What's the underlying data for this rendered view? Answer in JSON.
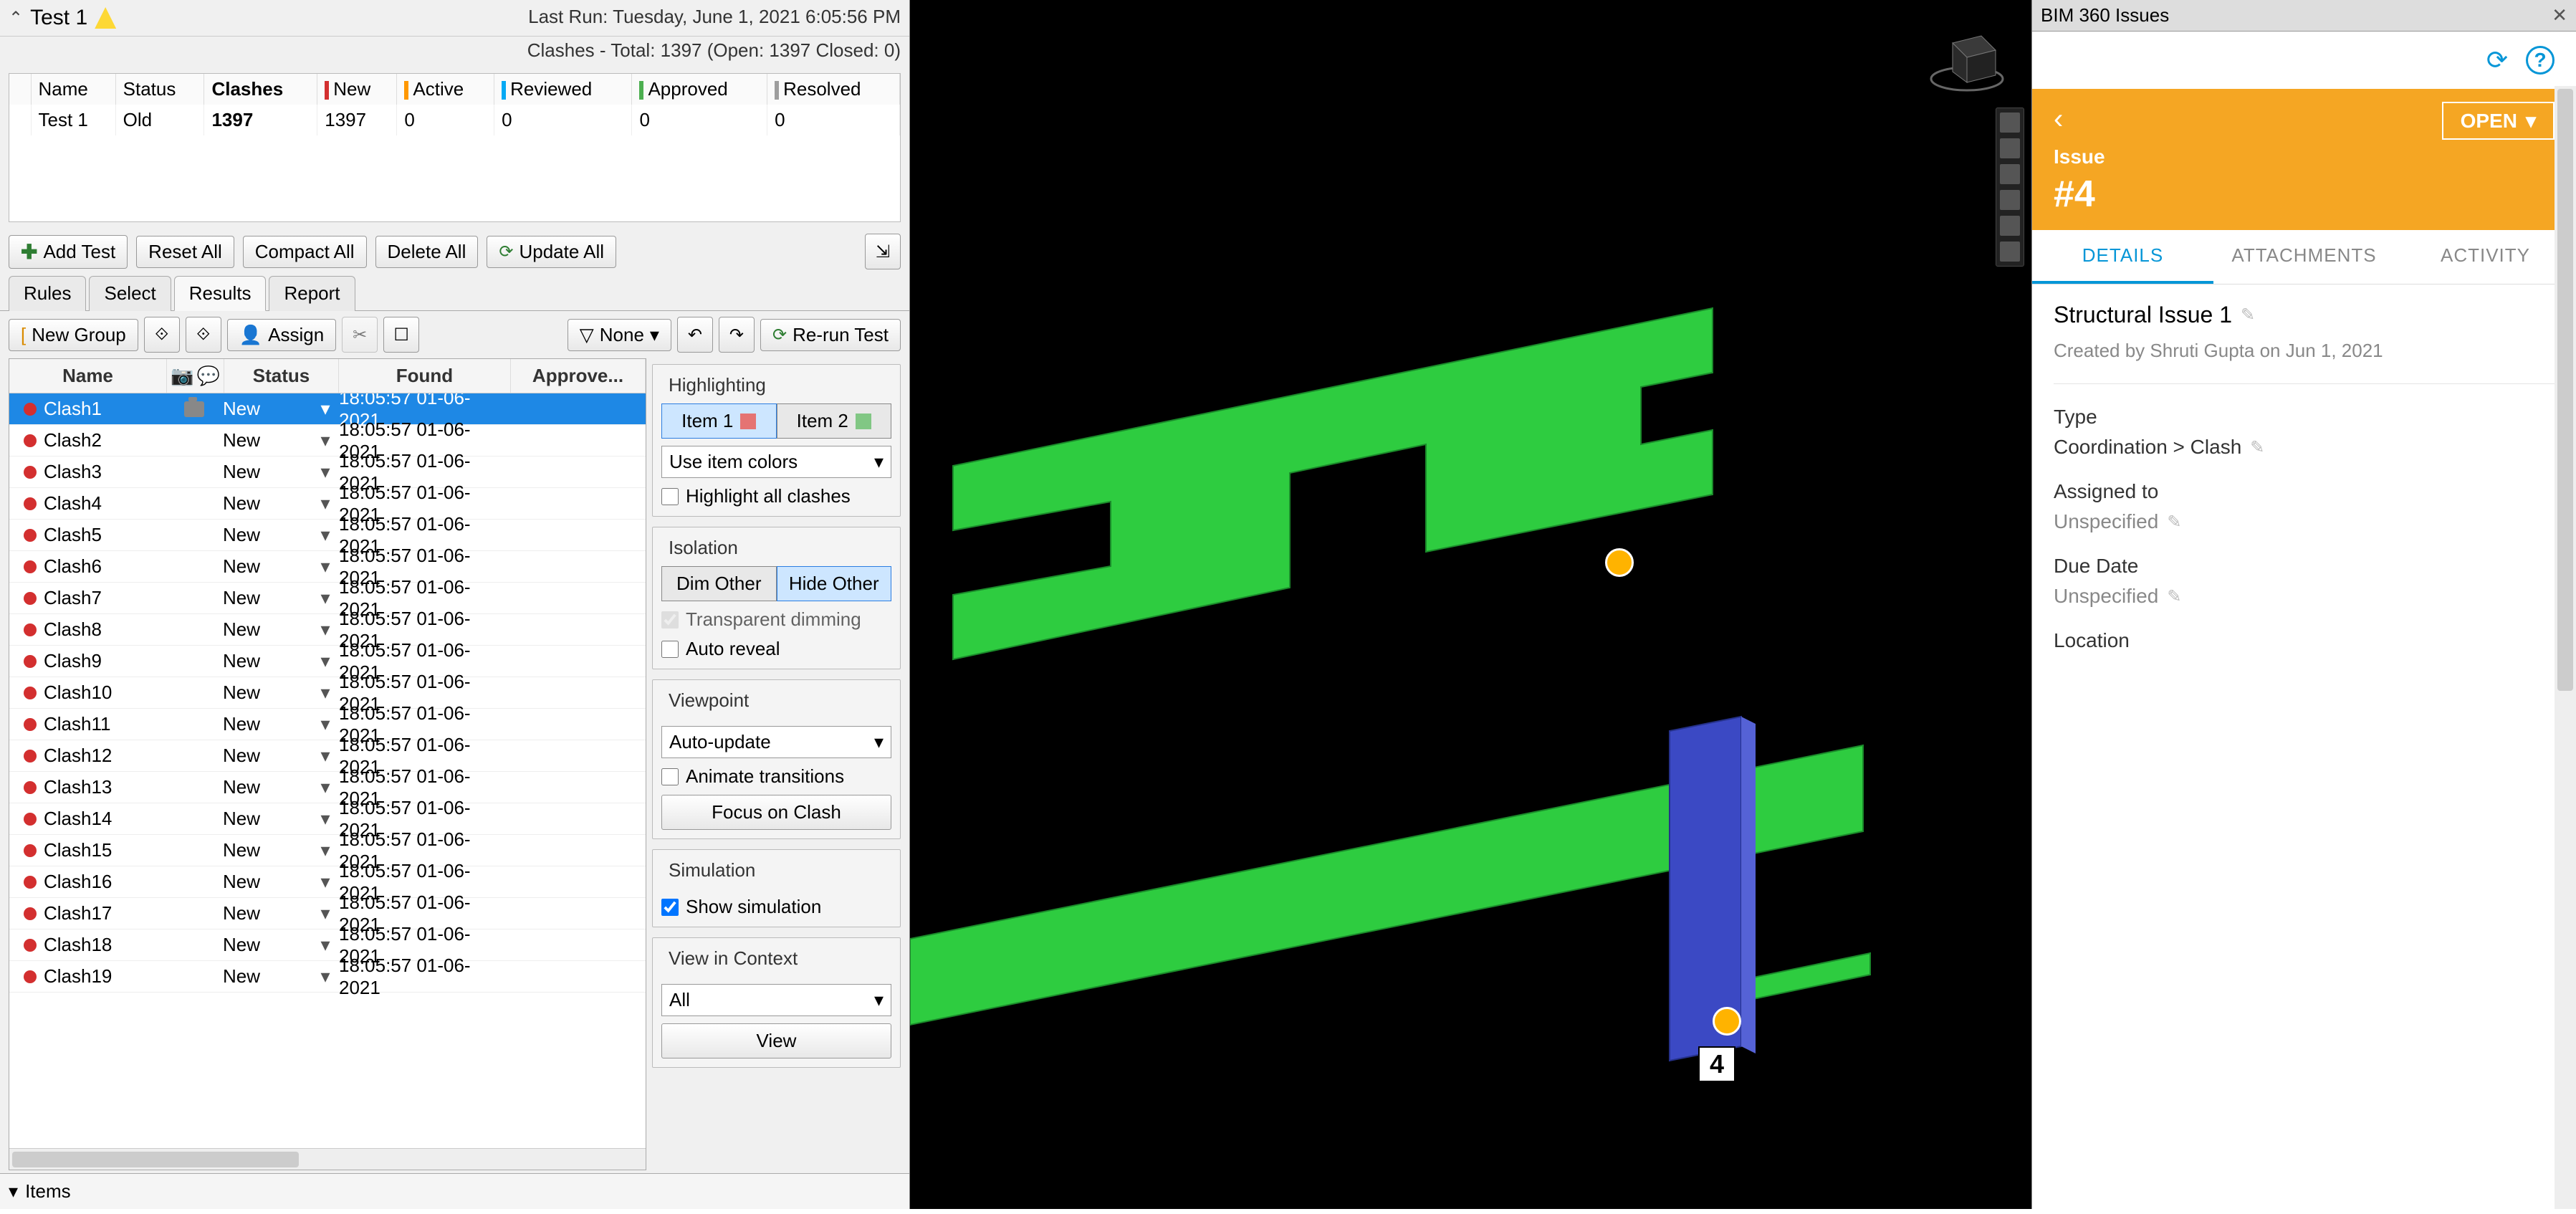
{
  "test": {
    "title": "Test 1",
    "lastRunLabel": "Last Run:",
    "lastRunValue": "Tuesday, June 1, 2021 6:05:56 PM",
    "clashSummary": "Clashes - Total: 1397 (Open: 1397 Closed: 0)"
  },
  "summaryHead": {
    "name": "Name",
    "status": "Status",
    "clashes": "Clashes",
    "new": "New",
    "active": "Active",
    "reviewed": "Reviewed",
    "approved": "Approved",
    "resolved": "Resolved"
  },
  "summaryRow": {
    "name": "Test 1",
    "status": "Old",
    "clashes": "1397",
    "new": "1397",
    "active": "0",
    "reviewed": "0",
    "approved": "0",
    "resolved": "0"
  },
  "buttons": {
    "addTest": "Add Test",
    "resetAll": "Reset All",
    "compactAll": "Compact All",
    "deleteAll": "Delete All",
    "updateAll": "Update All"
  },
  "tabs": {
    "rules": "Rules",
    "select": "Select",
    "results": "Results",
    "report": "Report"
  },
  "toolbar": {
    "newGroup": "New Group",
    "assign": "Assign",
    "none": "None",
    "rerun": "Re-run Test"
  },
  "resultsHead": {
    "name": "Name",
    "status": "Status",
    "found": "Found",
    "approved": "Approve..."
  },
  "clashes": [
    {
      "name": "Clash1",
      "status": "New",
      "found": "18:05:57 01-06-2021",
      "selected": true,
      "cam": true
    },
    {
      "name": "Clash2",
      "status": "New",
      "found": "18:05:57 01-06-2021"
    },
    {
      "name": "Clash3",
      "status": "New",
      "found": "18:05:57 01-06-2021"
    },
    {
      "name": "Clash4",
      "status": "New",
      "found": "18:05:57 01-06-2021"
    },
    {
      "name": "Clash5",
      "status": "New",
      "found": "18:05:57 01-06-2021"
    },
    {
      "name": "Clash6",
      "status": "New",
      "found": "18:05:57 01-06-2021"
    },
    {
      "name": "Clash7",
      "status": "New",
      "found": "18:05:57 01-06-2021"
    },
    {
      "name": "Clash8",
      "status": "New",
      "found": "18:05:57 01-06-2021"
    },
    {
      "name": "Clash9",
      "status": "New",
      "found": "18:05:57 01-06-2021"
    },
    {
      "name": "Clash10",
      "status": "New",
      "found": "18:05:57 01-06-2021"
    },
    {
      "name": "Clash11",
      "status": "New",
      "found": "18:05:57 01-06-2021"
    },
    {
      "name": "Clash12",
      "status": "New",
      "found": "18:05:57 01-06-2021"
    },
    {
      "name": "Clash13",
      "status": "New",
      "found": "18:05:57 01-06-2021"
    },
    {
      "name": "Clash14",
      "status": "New",
      "found": "18:05:57 01-06-2021"
    },
    {
      "name": "Clash15",
      "status": "New",
      "found": "18:05:57 01-06-2021"
    },
    {
      "name": "Clash16",
      "status": "New",
      "found": "18:05:57 01-06-2021"
    },
    {
      "name": "Clash17",
      "status": "New",
      "found": "18:05:57 01-06-2021"
    },
    {
      "name": "Clash18",
      "status": "New",
      "found": "18:05:57 01-06-2021"
    },
    {
      "name": "Clash19",
      "status": "New",
      "found": "18:05:57 01-06-2021"
    }
  ],
  "settings": {
    "highlighting": "Highlighting",
    "item1": "Item 1",
    "item2": "Item 2",
    "useItemColors": "Use item colors",
    "highlightAll": "Highlight all clashes",
    "isolation": "Isolation",
    "dimOther": "Dim Other",
    "hideOther": "Hide Other",
    "transparentDim": "Transparent dimming",
    "autoReveal": "Auto reveal",
    "viewpoint": "Viewpoint",
    "autoUpdate": "Auto-update",
    "animate": "Animate transitions",
    "focus": "Focus on Clash",
    "simulation": "Simulation",
    "showSim": "Show simulation",
    "viewContext": "View in Context",
    "all": "All",
    "view": "View"
  },
  "items": "Items",
  "bim": {
    "title": "BIM 360 Issues",
    "open": "OPEN",
    "issueLbl": "Issue",
    "issueNum": "#4",
    "tabs": {
      "details": "DETAILS",
      "attachments": "ATTACHMENTS",
      "activity": "ACTIVITY"
    },
    "issueTitle": "Structural Issue 1",
    "createdBy": "Created by Shruti Gupta on Jun 1, 2021",
    "type": "Type",
    "typeVal": "Coordination > Clash",
    "assigned": "Assigned to",
    "unspecified": "Unspecified",
    "due": "Due Date",
    "location": "Location"
  },
  "viewer": {
    "issueLabel": "4"
  }
}
